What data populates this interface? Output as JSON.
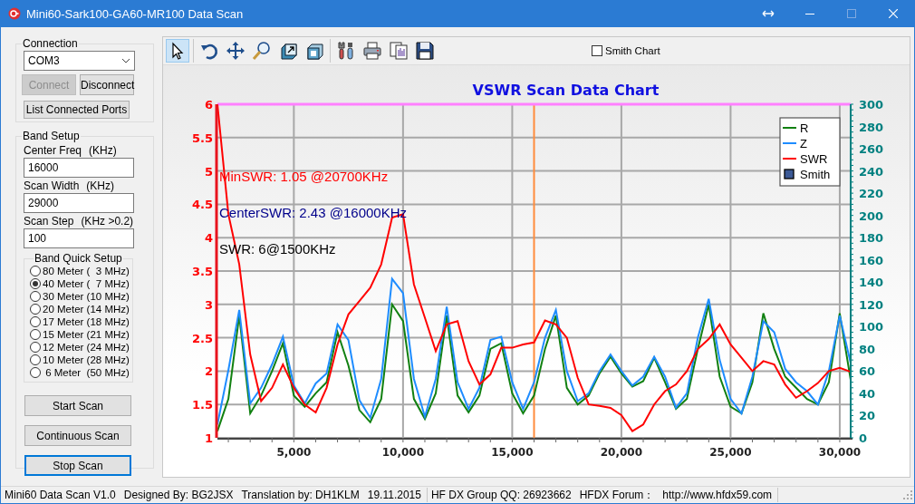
{
  "window": {
    "title": "Mini60-Sark100-GA60-MR100 Data Scan",
    "maximize_disabled": true
  },
  "connection": {
    "title": "Connection",
    "port": "COM3",
    "buttons": [
      {
        "label": "Connect",
        "disabled": true
      },
      {
        "label": "Disconnect",
        "disabled": false
      }
    ],
    "list_button": "List Connected Ports"
  },
  "band_setup": {
    "title": "Band Setup",
    "fields": [
      {
        "label": "Center Freq",
        "unit": "(KHz)",
        "value": "16000"
      },
      {
        "label": "Scan Width",
        "unit": "(KHz)",
        "value": "29000"
      },
      {
        "label": "Scan Step",
        "unit": "(KHz >0.2)",
        "value": "100"
      }
    ],
    "quick_setup": {
      "title": "Band Quick Setup",
      "options": [
        {
          "label": "80 Meter (  3 MHz)",
          "selected": false
        },
        {
          "label": "40 Meter (  7 MHz)",
          "selected": true
        },
        {
          "label": "30 Meter (10 MHz)",
          "selected": false
        },
        {
          "label": "20 Meter (14 MHz)",
          "selected": false
        },
        {
          "label": "17 Meter (18 MHz)",
          "selected": false
        },
        {
          "label": "15 Meter (21 MHz)",
          "selected": false
        },
        {
          "label": "12 Meter (24 MHz)",
          "selected": false
        },
        {
          "label": "10 Meter (28 MHz)",
          "selected": false
        },
        {
          "label": " 6 Meter  (50 MHz)",
          "selected": false
        }
      ]
    }
  },
  "scan_buttons": [
    {
      "label": "Start Scan",
      "focused": false
    },
    {
      "label": "Continuous Scan",
      "focused": false
    },
    {
      "label": "Stop Scan",
      "focused": true
    }
  ],
  "toolbar": {
    "tools": [
      {
        "kind": "pointer",
        "selected": true
      },
      {
        "kind": "undo",
        "selected": false
      },
      {
        "kind": "move",
        "selected": false
      },
      {
        "kind": "zoom",
        "selected": false
      },
      {
        "kind": "export",
        "selected": false
      },
      {
        "kind": "cube",
        "selected": false
      },
      {
        "kind": "tools",
        "selected": false
      },
      {
        "kind": "print",
        "selected": false
      },
      {
        "kind": "copy",
        "selected": false
      },
      {
        "kind": "save",
        "selected": false
      }
    ],
    "smith_chart": {
      "label": "Smith Chart",
      "checked": false
    }
  },
  "chart": {
    "chart_data": {
      "type": "line",
      "title": "VSWR Scan Data Chart",
      "xlim": [
        1500,
        30500
      ],
      "ylim": [
        1,
        6
      ],
      "y2lim": [
        0,
        300
      ],
      "xticks": [
        {
          "value": 5000,
          "label": "5,000"
        },
        {
          "value": 10000,
          "label": "10,000"
        },
        {
          "value": 15000,
          "label": "15,000"
        },
        {
          "value": 20000,
          "label": "20,000"
        },
        {
          "value": 25000,
          "label": "25,000"
        },
        {
          "value": 30000,
          "label": "30,000"
        }
      ],
      "yticks": [
        1,
        {
          "value": 1.5,
          "label": "1.5"
        },
        2,
        {
          "value": 2.5,
          "label": "2.5"
        },
        3,
        {
          "value": 3.5,
          "label": "3.5"
        },
        4,
        {
          "value": 4.5,
          "label": "4.5"
        },
        5,
        {
          "value": 5.5,
          "label": "5.5"
        },
        6
      ],
      "y2ticks": [
        0,
        20,
        40,
        60,
        80,
        100,
        120,
        140,
        160,
        180,
        200,
        220,
        240,
        260,
        280,
        300
      ],
      "x": [
        1500,
        2000,
        2500,
        3000,
        3500,
        4000,
        4500,
        5000,
        5500,
        6000,
        6500,
        7000,
        7500,
        8000,
        8500,
        9000,
        9500,
        10000,
        10500,
        11000,
        11500,
        12000,
        12500,
        13000,
        13500,
        14000,
        14500,
        15000,
        15500,
        16000,
        16500,
        17000,
        17500,
        18000,
        18500,
        19000,
        19500,
        20000,
        20500,
        21000,
        21500,
        22000,
        22500,
        23000,
        23500,
        24000,
        24500,
        25000,
        25500,
        26000,
        26500,
        27000,
        27500,
        28000,
        28500,
        29000,
        29500,
        30000,
        30500
      ],
      "series": [
        {
          "name": "R",
          "color": "#118011",
          "axis": "y2",
          "values": [
            6,
            35,
            110,
            22,
            38,
            60,
            85,
            38,
            28,
            40,
            50,
            95,
            65,
            25,
            14,
            35,
            120,
            105,
            35,
            17,
            40,
            110,
            38,
            23,
            38,
            80,
            85,
            40,
            22,
            38,
            80,
            110,
            45,
            30,
            38,
            58,
            73,
            58,
            46,
            51,
            72,
            50,
            26,
            35,
            80,
            120,
            55,
            28,
            22,
            50,
            112,
            80,
            55,
            45,
            35,
            30,
            50,
            112,
            52
          ]
        },
        {
          "name": "Z",
          "color": "#1e8cff",
          "axis": "y2",
          "values": [
            12,
            61,
            115,
            31,
            45,
            66,
            91,
            47,
            31,
            49,
            58,
            102,
            88,
            34,
            18,
            53,
            143,
            130,
            53,
            19,
            53,
            118,
            50,
            26,
            45,
            88,
            91,
            50,
            26,
            50,
            90,
            115,
            60,
            33,
            40,
            60,
            75,
            60,
            47,
            55,
            73,
            55,
            27,
            40,
            90,
            125,
            70,
            35,
            22,
            55,
            105,
            95,
            62,
            50,
            42,
            30,
            60,
            110,
            67
          ]
        },
        {
          "name": "SWR",
          "color": "#ff0000",
          "values": [
            6.0,
            4.35,
            3.6,
            2.25,
            1.55,
            1.75,
            2.1,
            1.75,
            1.5,
            1.38,
            1.75,
            2.4,
            2.85,
            3.05,
            3.25,
            3.6,
            4.3,
            4.35,
            3.3,
            2.8,
            2.3,
            2.7,
            2.75,
            2.15,
            1.8,
            1.95,
            2.35,
            2.35,
            2.4,
            2.43,
            2.76,
            2.7,
            2.5,
            1.9,
            1.5,
            1.48,
            1.45,
            1.34,
            1.1,
            1.2,
            1.5,
            1.7,
            1.8,
            2.0,
            2.33,
            2.48,
            2.7,
            2.4,
            2.2,
            2.0,
            2.15,
            2.1,
            1.8,
            1.6,
            1.7,
            1.82,
            2.0,
            2.05,
            1.99
          ]
        }
      ],
      "annotations": [
        {
          "text": "MinSWR: 1.05 @20700KHz"
        },
        {
          "text": "CenterSWR: 2.43 @16000KHz"
        },
        {
          "text": "SWR: 6@1500KHz"
        }
      ],
      "ref_lines": [
        {
          "axis": "x",
          "value": 16000,
          "color": "#ff8c3c"
        },
        {
          "axis": "y",
          "value": 6,
          "color": "#ff80ff"
        }
      ],
      "grid": true,
      "legend": true
    },
    "smith_legend": {
      "label": "Smith",
      "color": "#3c5a96"
    }
  },
  "status_bar": {
    "panels": [
      {
        "items": [
          "Mini60 Data Scan V1.0",
          "Designed By: BG2JSX",
          "Translation by: DH1KLM",
          "19.11.2015"
        ]
      },
      {
        "items": [
          "HF DX Group QQ: 26923662",
          "HFDX Forum：",
          "http://www.hfdx59.com"
        ]
      }
    ]
  }
}
